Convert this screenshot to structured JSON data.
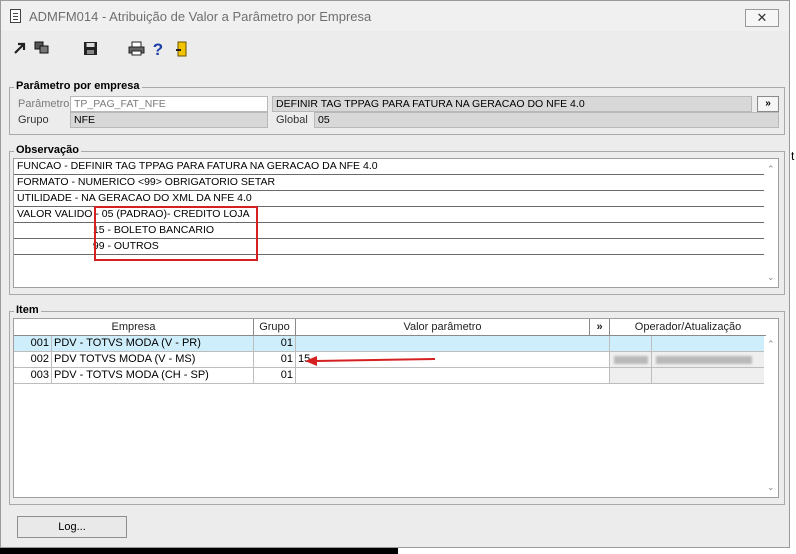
{
  "window": {
    "title": "ADMFM014 - Atribuição de Valor a Parâmetro por Empresa",
    "close_label": "✕"
  },
  "toolbar": {
    "icons": [
      "arrow-icon",
      "copy-icon",
      "save-icon",
      "print-icon",
      "help-icon",
      "exit-icon"
    ],
    "help_label": "?"
  },
  "param_group": {
    "title": "Parâmetro por empresa",
    "parametro_label": "Parâmetro",
    "parametro_value": "TP_PAG_FAT_NFE",
    "descricao_value": "DEFINIR TAG TPPAG PARA FATURA NA GERACAO DO NFE 4.0",
    "more_label": "»",
    "grupo_label": "Grupo",
    "grupo_value": "NFE",
    "global_label": "Global",
    "global_value": "05"
  },
  "obs_group": {
    "title": "Observação",
    "lines": [
      "FUNCAO - DEFINIR TAG TPPAG PARA FATURA NA GERACAO DA NFE 4.0",
      "FORMATO - NUMERICO <99> OBRIGATORIO SETAR",
      "UTILIDADE - NA GERACAO DO XML DA NFE 4.0",
      "VALOR VALIDO - 05 (PADRAO)- CREDITO LOJA",
      "                          15 - BOLETO BANCARIO",
      "                          99 - OUTROS"
    ]
  },
  "item_group": {
    "title": "Item",
    "headers": {
      "empresa": "Empresa",
      "grupo": "Grupo",
      "valor": "Valor parâmetro",
      "more": "»",
      "operador": "Operador/Atualização"
    },
    "rows": [
      {
        "code": "001",
        "empresa": "PDV - TOTVS MODA (V - PR)",
        "grupo": "01",
        "valor": ""
      },
      {
        "code": "002",
        "empresa": "PDV TOTVS MODA  (V - MS)",
        "grupo": "01",
        "valor": "15"
      },
      {
        "code": "003",
        "empresa": "PDV - TOTVS MODA (CH - SP)",
        "grupo": "01",
        "valor": ""
      }
    ]
  },
  "log_button": "Log...",
  "side_mark": "t",
  "colors": {
    "annotation_red": "#d42020",
    "selected_row": "#cfeefb",
    "readonly_field": "#d8d8d8"
  }
}
